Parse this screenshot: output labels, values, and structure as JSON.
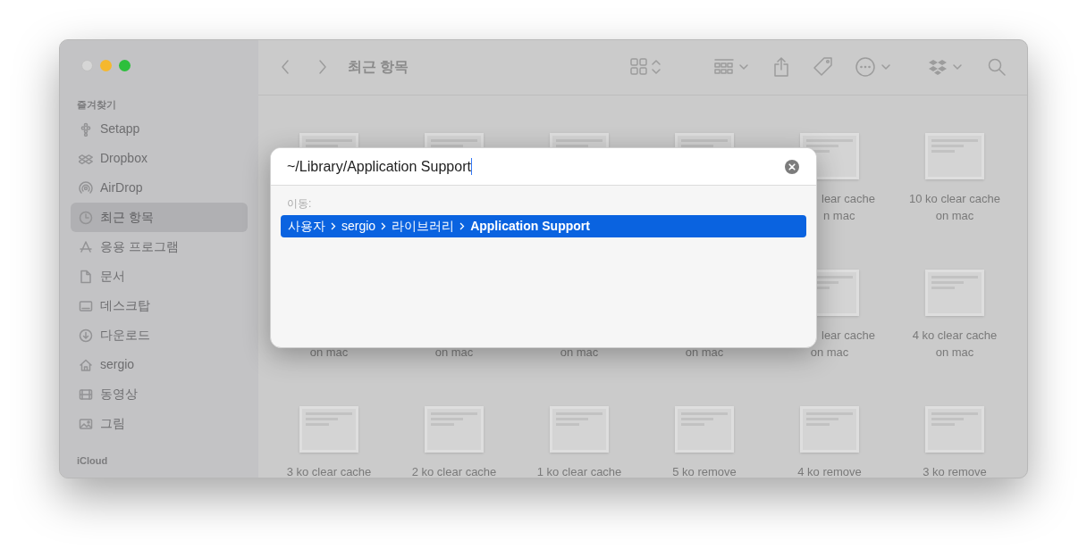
{
  "window": {
    "title": "최근 항목"
  },
  "sidebar": {
    "sections": [
      {
        "title": "즐겨찾기",
        "items": [
          {
            "label": "Setapp",
            "selected": false
          },
          {
            "label": "Dropbox",
            "selected": false
          },
          {
            "label": "AirDrop",
            "selected": false
          },
          {
            "label": "최근 항목",
            "selected": true
          },
          {
            "label": "응용 프로그램",
            "selected": false
          },
          {
            "label": "문서",
            "selected": false
          },
          {
            "label": "데스크탑",
            "selected": false
          },
          {
            "label": "다운로드",
            "selected": false
          },
          {
            "label": "sergio",
            "selected": false
          },
          {
            "label": "동영상",
            "selected": false
          },
          {
            "label": "그림",
            "selected": false
          }
        ]
      },
      {
        "title": "iCloud"
      }
    ]
  },
  "files": [
    {
      "kind": "thumb_only"
    },
    {
      "kind": "thumb_only"
    },
    {
      "kind": "thumb_only"
    },
    {
      "kind": "thumb_only"
    },
    {
      "kind": "covered",
      "lines": [
        "lear cache",
        "n mac"
      ]
    },
    {
      "kind": "full",
      "lines": [
        "10 ko clear cache",
        "on mac"
      ]
    },
    {
      "kind": "label_only",
      "lines": [
        "on mac"
      ]
    },
    {
      "kind": "label_only",
      "lines": [
        "on mac"
      ]
    },
    {
      "kind": "label_only",
      "lines": [
        "on mac"
      ]
    },
    {
      "kind": "label_only",
      "lines": [
        "on mac"
      ]
    },
    {
      "kind": "partial",
      "lines": [
        "lear cache",
        "on mac"
      ]
    },
    {
      "kind": "full",
      "lines": [
        "4 ko clear cache",
        "on mac"
      ]
    },
    {
      "kind": "full",
      "lines": [
        "3 ko clear cache"
      ]
    },
    {
      "kind": "full",
      "lines": [
        "2 ko clear cache"
      ]
    },
    {
      "kind": "full",
      "lines": [
        "1 ko clear cache"
      ]
    },
    {
      "kind": "full",
      "lines": [
        "5 ko remove"
      ]
    },
    {
      "kind": "full",
      "lines": [
        "4 ko remove"
      ]
    },
    {
      "kind": "full",
      "lines": [
        "3 ko remove"
      ]
    }
  ],
  "go_to_dialog": {
    "path_field": {
      "value": "~/Library/Application Support"
    },
    "section_label": "이동:",
    "suggestions": [
      {
        "selected": true,
        "path": [
          "사용자",
          "sergio",
          "라이브러리",
          "Application Support"
        ]
      }
    ]
  }
}
